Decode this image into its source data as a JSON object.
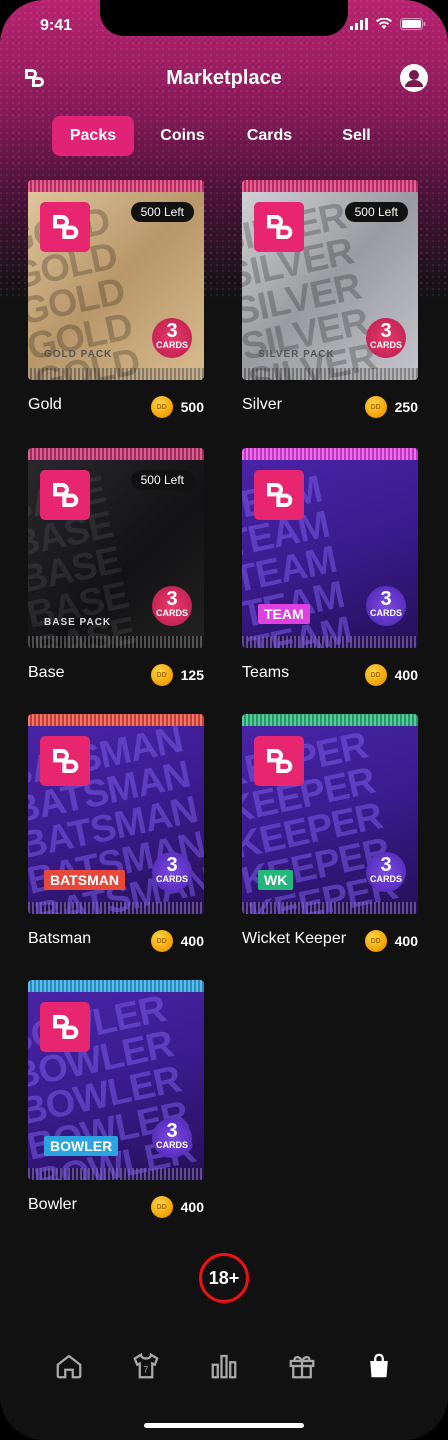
{
  "status": {
    "time": "9:41"
  },
  "header": {
    "title": "Marketplace"
  },
  "tabs": [
    {
      "label": "Packs",
      "active": true
    },
    {
      "label": "Coins"
    },
    {
      "label": "Cards"
    },
    {
      "label": "Sell"
    }
  ],
  "packs": [
    {
      "name": "Gold",
      "price": "500",
      "left": "500 Left",
      "pattern": "GOLD",
      "pack_label": "GOLD PACK",
      "cards": "3",
      "cards_label": "CARDS",
      "color": "#c8a878"
    },
    {
      "name": "Silver",
      "price": "250",
      "left": "500 Left",
      "pattern": "SILVER",
      "pack_label": "SILVER PACK",
      "cards": "3",
      "cards_label": "CARDS",
      "color": "#a8a9ae"
    },
    {
      "name": "Base",
      "price": "125",
      "left": "500 Left",
      "pattern": "BASE",
      "pack_label": "BASE PACK",
      "cards": "3",
      "cards_label": "CARDS",
      "color": "#1c1c1e"
    },
    {
      "name": "Teams",
      "price": "400",
      "pattern": "TEAM",
      "tag": "TEAM",
      "cards": "3",
      "cards_label": "CARDS",
      "color": "#3b1b8f",
      "accent": "#e040e0"
    },
    {
      "name": "Batsman",
      "price": "400",
      "pattern": "BATSMAN",
      "tag": "BATSMAN",
      "cards": "3",
      "cards_label": "CARDS",
      "color": "#3b1b8f",
      "accent": "#e8483c"
    },
    {
      "name": "Wicket Keeper",
      "price": "400",
      "pattern": "KEEPER",
      "tag": "WK",
      "cards": "3",
      "cards_label": "CARDS",
      "color": "#3b1b8f",
      "accent": "#25b67a"
    },
    {
      "name": "Bowler",
      "price": "400",
      "pattern": "BOWLER",
      "tag": "BOWLER",
      "cards": "3",
      "cards_label": "CARDS",
      "color": "#3b1b8f",
      "accent": "#2aa3e0"
    }
  ],
  "coin_label": "DD",
  "age_badge": "18+",
  "nav": [
    "home-icon",
    "jersey-icon",
    "leaderboard-icon",
    "gift-icon",
    "shopping-bag-icon"
  ]
}
